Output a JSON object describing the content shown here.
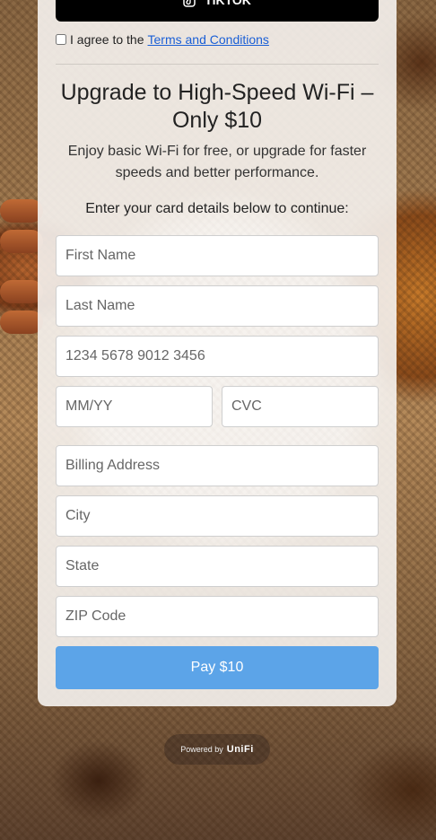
{
  "social": {
    "tiktok_label": "TIKTOK"
  },
  "terms": {
    "prefix": "I agree to the",
    "link_label": "Terms and Conditions",
    "checked": false
  },
  "upgrade": {
    "title": "Upgrade to High-Speed Wi-Fi – Only $10",
    "description": "Enjoy basic Wi-Fi for free, or upgrade for faster speeds and better performance.",
    "instruction": "Enter your card details below to continue:"
  },
  "form": {
    "first_name_placeholder": "First Name",
    "last_name_placeholder": "Last Name",
    "card_number_placeholder": "1234 5678 9012 3456",
    "expiry_placeholder": "MM/YY",
    "cvc_placeholder": "CVC",
    "billing_address_placeholder": "Billing Address",
    "city_placeholder": "City",
    "state_placeholder": "State",
    "zip_placeholder": "ZIP Code",
    "pay_label": "Pay $10"
  },
  "footer": {
    "powered_prefix": "Powered by",
    "brand": "UniFi"
  },
  "colors": {
    "pay_button": "#5ca4e8",
    "link": "#1a5fd6",
    "tiktok_button": "#000000"
  },
  "icons": {
    "tiktok": "tiktok-icon"
  }
}
